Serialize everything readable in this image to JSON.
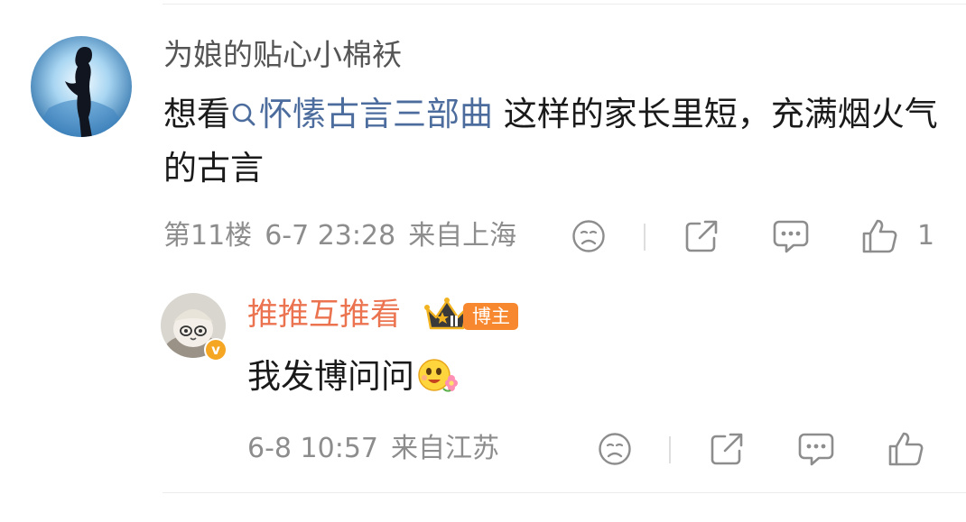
{
  "comment": {
    "username": "为娘的贴心小棉袄",
    "text_before": "想看",
    "topic": "怀愫古言三部曲",
    "text_after": " 这样的家长里短，充满烟火气的古言",
    "floor": "第11楼",
    "time": "6-7 23:28",
    "location": "来自上海",
    "like_count": "1",
    "icons": [
      "dislike-icon",
      "share-icon",
      "comment-icon",
      "like-icon"
    ]
  },
  "reply": {
    "username": "推推互推看",
    "role_tag": "博主",
    "vip_badge": "v",
    "text": "我发博问问",
    "time": "6-8 10:57",
    "location": "来自江苏",
    "icons": [
      "dislike-icon",
      "share-icon",
      "comment-icon",
      "like-icon"
    ]
  },
  "colors": {
    "username": "#555555",
    "author_username": "#eb7350",
    "topic_link": "#4b6c9c",
    "meta_text": "#8d8d8d",
    "author_tag_bg": "#f7882f",
    "vip_badge_bg": "#f5a623"
  }
}
